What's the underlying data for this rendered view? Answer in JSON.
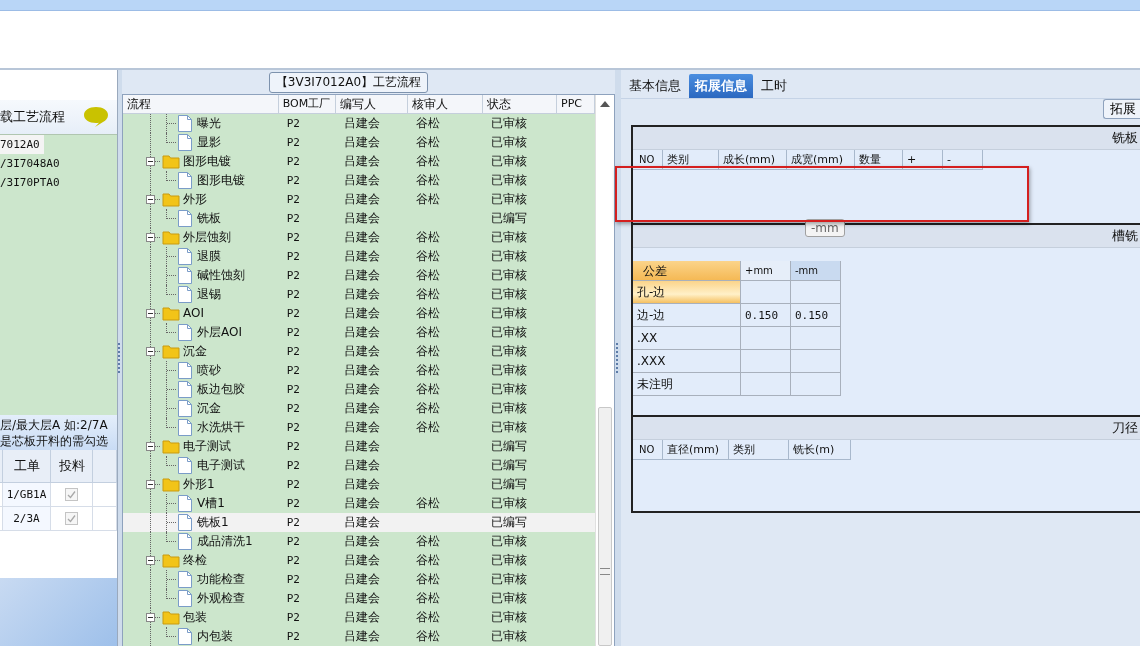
{
  "left_panel": {
    "title": "载工艺流程",
    "items": [
      {
        "label": "7012A0",
        "selected": true
      },
      {
        "label": "/3I7048A0",
        "selected": false
      },
      {
        "label": "/3I70PTA0",
        "selected": false
      }
    ],
    "note_lines": [
      "层/最大层A 如:2/7A",
      "是芯板开料的需勾选"
    ],
    "order_table": {
      "columns": [
        "工单",
        "投料"
      ],
      "rows": [
        {
          "order": "1/GB1A",
          "checked": true
        },
        {
          "order": "2/3A",
          "checked": true
        }
      ]
    }
  },
  "flow_panel": {
    "title": "【3V3I7012A0】工艺流程",
    "columns": [
      "流程",
      "BOM工厂",
      "编写人",
      "核审人",
      "状态",
      "PPC"
    ],
    "tree": [
      {
        "children": [
          {
            "label": "曝光",
            "bom": "P2",
            "author": "吕建会",
            "reviewer": "谷松",
            "status": "已审核",
            "selected": false
          },
          {
            "label": "显影",
            "bom": "P2",
            "author": "吕建会",
            "reviewer": "谷松",
            "status": "已审核",
            "selected": false
          }
        ]
      },
      {
        "label": "图形电镀",
        "bom": "P2",
        "author": "吕建会",
        "reviewer": "谷松",
        "status": "已审核",
        "selected": false,
        "expanded": true,
        "children": [
          {
            "label": "图形电镀",
            "bom": "P2",
            "author": "吕建会",
            "reviewer": "谷松",
            "status": "已审核",
            "selected": false
          }
        ]
      },
      {
        "label": "外形",
        "bom": "P2",
        "author": "吕建会",
        "reviewer": "谷松",
        "status": "已审核",
        "selected": false,
        "expanded": true,
        "children": [
          {
            "label": "铣板",
            "bom": "P2",
            "author": "吕建会",
            "status": "已编写",
            "selected": false
          }
        ]
      },
      {
        "label": "外层蚀刻",
        "bom": "P2",
        "author": "吕建会",
        "reviewer": "谷松",
        "status": "已审核",
        "selected": false,
        "expanded": true,
        "children": [
          {
            "label": "退膜",
            "bom": "P2",
            "author": "吕建会",
            "reviewer": "谷松",
            "status": "已审核",
            "selected": false
          },
          {
            "label": "碱性蚀刻",
            "bom": "P2",
            "author": "吕建会",
            "reviewer": "谷松",
            "status": "已审核",
            "selected": false
          },
          {
            "label": "退锡",
            "bom": "P2",
            "author": "吕建会",
            "reviewer": "谷松",
            "status": "已审核",
            "selected": false
          }
        ]
      },
      {
        "label": "AOI",
        "bom": "P2",
        "author": "吕建会",
        "reviewer": "谷松",
        "status": "已审核",
        "selected": false,
        "expanded": true,
        "children": [
          {
            "label": "外层AOI",
            "bom": "P2",
            "author": "吕建会",
            "reviewer": "谷松",
            "status": "已审核",
            "selected": false
          }
        ]
      },
      {
        "label": "沉金",
        "bom": "P2",
        "author": "吕建会",
        "reviewer": "谷松",
        "status": "已审核",
        "selected": false,
        "expanded": true,
        "children": [
          {
            "label": "喷砂",
            "bom": "P2",
            "author": "吕建会",
            "reviewer": "谷松",
            "status": "已审核",
            "selected": false
          },
          {
            "label": "板边包胶",
            "bom": "P2",
            "author": "吕建会",
            "reviewer": "谷松",
            "status": "已审核",
            "selected": false
          },
          {
            "label": "沉金",
            "bom": "P2",
            "author": "吕建会",
            "reviewer": "谷松",
            "status": "已审核",
            "selected": false
          },
          {
            "label": "水洗烘干",
            "bom": "P2",
            "author": "吕建会",
            "reviewer": "谷松",
            "status": "已审核",
            "selected": false
          }
        ]
      },
      {
        "label": "电子测试",
        "bom": "P2",
        "author": "吕建会",
        "status": "已编写",
        "selected": false,
        "expanded": true,
        "children": [
          {
            "label": "电子测试",
            "bom": "P2",
            "author": "吕建会",
            "status": "已编写",
            "selected": false
          }
        ]
      },
      {
        "label": "外形1",
        "bom": "P2",
        "author": "吕建会",
        "status": "已编写",
        "selected": false,
        "expanded": true,
        "children": [
          {
            "label": "V槽1",
            "bom": "P2",
            "author": "吕建会",
            "reviewer": "谷松",
            "status": "已审核",
            "selected": false
          },
          {
            "label": "铣板1",
            "bom": "P2",
            "author": "吕建会",
            "status": "已编写",
            "selected": true
          },
          {
            "label": "成品清洗1",
            "bom": "P2",
            "author": "吕建会",
            "reviewer": "谷松",
            "status": "已审核",
            "selected": false
          }
        ]
      },
      {
        "label": "终检",
        "bom": "P2",
        "author": "吕建会",
        "reviewer": "谷松",
        "status": "已审核",
        "selected": false,
        "expanded": true,
        "children": [
          {
            "label": "功能检查",
            "bom": "P2",
            "author": "吕建会",
            "reviewer": "谷松",
            "status": "已审核",
            "selected": false
          },
          {
            "label": "外观检查",
            "bom": "P2",
            "author": "吕建会",
            "reviewer": "谷松",
            "status": "已审核",
            "selected": false
          }
        ]
      },
      {
        "label": "包装",
        "bom": "P2",
        "author": "吕建会",
        "reviewer": "谷松",
        "status": "已审核",
        "selected": false,
        "expanded": true,
        "children": [
          {
            "label": "内包装",
            "bom": "P2",
            "author": "吕建会",
            "reviewer": "谷松",
            "status": "已审核",
            "selected": false
          }
        ]
      }
    ]
  },
  "detail_panel": {
    "tabs": [
      {
        "label": "基本信息",
        "selected": false
      },
      {
        "label": "拓展信息",
        "selected": true
      },
      {
        "label": "工时",
        "selected": false
      }
    ],
    "side_button": "拓展",
    "mill_params": {
      "title": "铣板",
      "columns": [
        "NO",
        "类别",
        "成长(mm)",
        "成宽(mm)",
        "数量",
        "+",
        "-"
      ]
    },
    "slot_tolerance": {
      "title": "槽铣",
      "tooltip": "-mm",
      "columns": [
        "公差",
        "+mm",
        "-mm"
      ],
      "rows": [
        {
          "label": "孔-边",
          "selected": true
        },
        {
          "label": "边-边",
          "plus": "0.150",
          "minus": "0.150",
          "selected": false
        },
        {
          "label": ".XX",
          "selected": false
        },
        {
          "label": ".XXX",
          "selected": false
        },
        {
          "label": "未注明",
          "selected": false
        }
      ]
    },
    "cutter_table": {
      "title": "刀径",
      "columns": [
        "NO",
        "直径(mm)",
        "类别",
        "铣长(m)"
      ]
    }
  }
}
